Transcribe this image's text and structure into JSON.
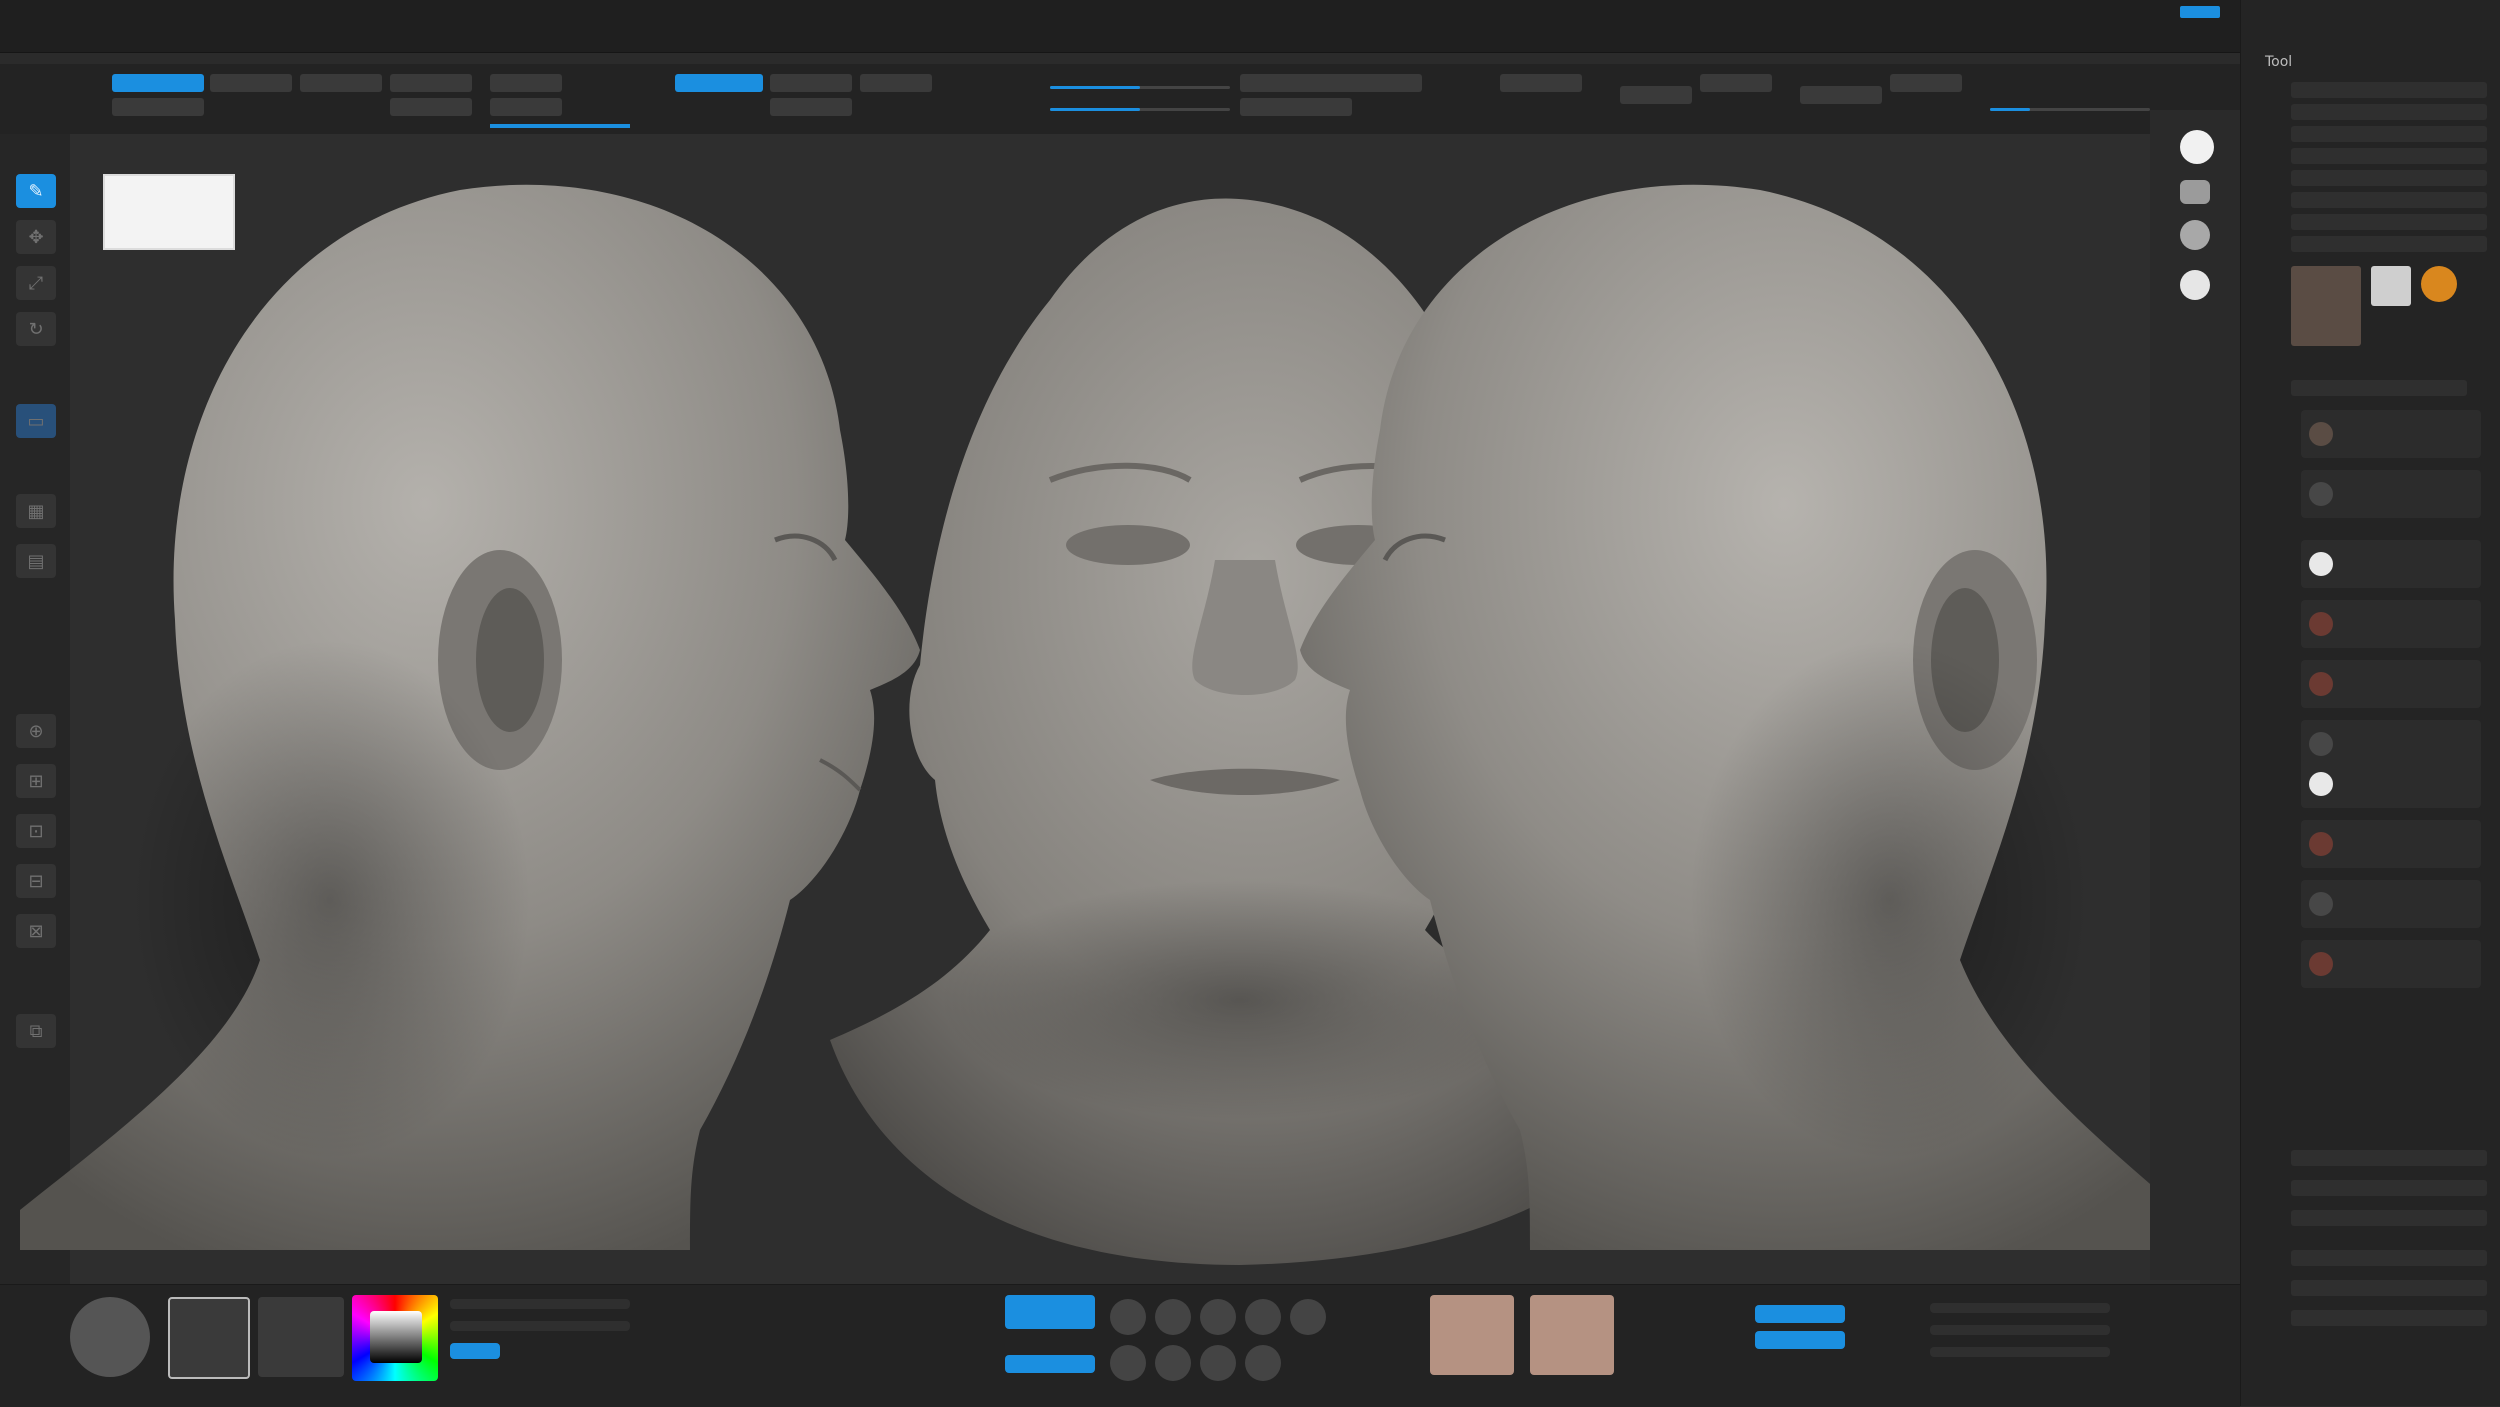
{
  "viewport_panel": {
    "title": "Tool"
  },
  "icons": [
    "draw-icon",
    "move-icon",
    "scale-icon",
    "rotate-icon",
    "frame-icon",
    "persp-icon",
    "floor-icon",
    "local-icon",
    "gear-icon",
    "folder-icon",
    "eye-icon"
  ],
  "colors": {
    "accent": "#1b8fe0",
    "background": "#2b2b2b",
    "canvas": "#2e2e2e",
    "clay": "#8f8d89",
    "highlight_orange": "#d98f2b"
  }
}
